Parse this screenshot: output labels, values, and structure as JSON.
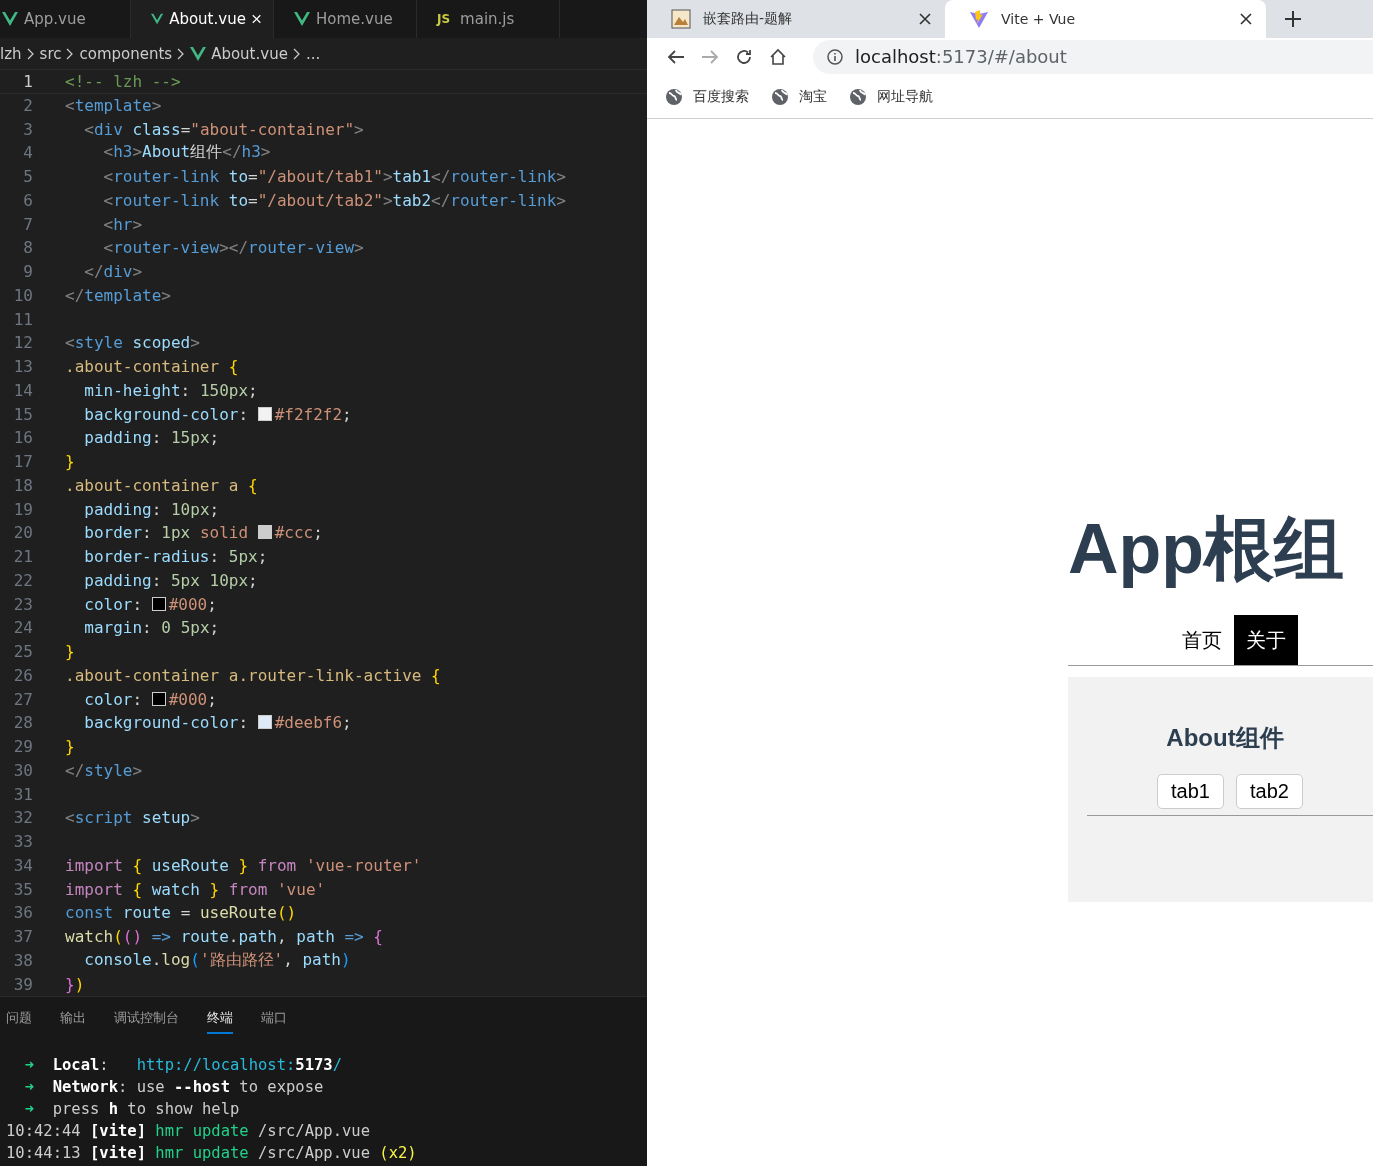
{
  "editor": {
    "tabs": [
      {
        "label": "App.vue",
        "kind": "vue",
        "selected": false
      },
      {
        "label": "About.vue",
        "kind": "vue",
        "selected": true
      },
      {
        "label": "Home.vue",
        "kind": "vue",
        "selected": false
      },
      {
        "label": "main.js",
        "kind": "js",
        "icon_text": "JS",
        "selected": false
      }
    ],
    "breadcrumbs": [
      {
        "label": "lzh",
        "kind": "folder"
      },
      {
        "label": "src",
        "kind": "folder"
      },
      {
        "label": "components",
        "kind": "folder"
      },
      {
        "label": "About.vue",
        "kind": "vue"
      },
      {
        "label": "...",
        "kind": "symbol"
      }
    ],
    "lines": [
      {
        "n": "1",
        "active": true,
        "text": "<!-- lzh -->"
      },
      {
        "n": "2",
        "active": false,
        "text": "<template>"
      },
      {
        "n": "3",
        "active": false,
        "text": "  <div class=\"about-container\">"
      },
      {
        "n": "4",
        "active": false,
        "text": "    <h3>About组件</h3>"
      },
      {
        "n": "5",
        "active": false,
        "text": "    <router-link to=\"/about/tab1\">tab1</router-link>"
      },
      {
        "n": "6",
        "active": false,
        "text": "    <router-link to=\"/about/tab2\">tab2</router-link>"
      },
      {
        "n": "7",
        "active": false,
        "text": "    <hr>"
      },
      {
        "n": "8",
        "active": false,
        "text": "    <router-view></router-view>"
      },
      {
        "n": "9",
        "active": false,
        "text": "  </div>"
      },
      {
        "n": "10",
        "active": false,
        "text": "</template>"
      },
      {
        "n": "11",
        "active": false
      },
      {
        "n": "12",
        "active": false,
        "text": "<style scoped>"
      },
      {
        "n": "13",
        "active": false,
        "text": ".about-container {"
      },
      {
        "n": "14",
        "active": false,
        "text": "  min-height: 150px;"
      },
      {
        "n": "15",
        "active": false,
        "text": "  background-color: #f2f2f2;"
      },
      {
        "n": "16",
        "active": false,
        "text": "  padding: 15px;"
      },
      {
        "n": "17",
        "active": false,
        "text": "}"
      },
      {
        "n": "18",
        "active": false,
        "text": ".about-container a {"
      },
      {
        "n": "19",
        "active": false,
        "text": "  padding: 10px;"
      },
      {
        "n": "20",
        "active": false,
        "text": "  border: 1px solid #ccc;"
      },
      {
        "n": "21",
        "active": false,
        "text": "  border-radius: 5px;"
      },
      {
        "n": "22",
        "active": false,
        "text": "  padding: 5px 10px;"
      },
      {
        "n": "23",
        "active": false,
        "text": "  color: #000;"
      },
      {
        "n": "24",
        "active": false,
        "text": "  margin: 0 5px;"
      },
      {
        "n": "25",
        "active": false,
        "text": "}"
      },
      {
        "n": "26",
        "active": false,
        "text": ".about-container a.router-link-active {"
      },
      {
        "n": "27",
        "active": false,
        "text": "  color: #000;"
      },
      {
        "n": "28",
        "active": false,
        "text": "  background-color: #deebf6;"
      },
      {
        "n": "29",
        "active": false,
        "text": "}"
      },
      {
        "n": "30",
        "active": false,
        "text": "</style>"
      },
      {
        "n": "31",
        "active": false
      },
      {
        "n": "32",
        "active": false,
        "text": "<script setup>"
      },
      {
        "n": "33",
        "active": false
      },
      {
        "n": "34",
        "active": false,
        "text": "import { useRoute } from 'vue-router'"
      },
      {
        "n": "35",
        "active": false,
        "text": "import { watch } from 'vue'"
      },
      {
        "n": "36",
        "active": false,
        "text": "const route = useRoute()"
      },
      {
        "n": "37",
        "active": false,
        "text": "watch(() => route.path, path => {"
      },
      {
        "n": "38",
        "active": false,
        "text": "  console.log('路由路径', path)"
      },
      {
        "n": "39",
        "active": false,
        "text": "})"
      }
    ]
  },
  "panel": {
    "tabs": [
      {
        "label": "问题",
        "selected": false
      },
      {
        "label": "输出",
        "selected": false
      },
      {
        "label": "调试控制台",
        "selected": false
      },
      {
        "label": "终端",
        "selected": true
      },
      {
        "label": "端口",
        "selected": false
      }
    ],
    "terminal_lines": [
      "  ➜  **Local**:   http://localhost:**5173**/",
      "  ➜  **Network**: use **--host** to expose",
      "  ➜  press **h** to show help",
      "10:42:44 **[vite]** hmr update /src/App.vue",
      "10:44:13 **[vite]** hmr update /src/App.vue (x2)"
    ]
  },
  "browser": {
    "tabs": [
      {
        "title": "嵌套路由-题解",
        "kind": "page",
        "selected": false
      },
      {
        "title": "Vite + Vue",
        "kind": "vite",
        "selected": true
      }
    ],
    "address": {
      "host": "localhost",
      "path": ":5173/#/about"
    },
    "bookmarks": [
      "百度搜索",
      "淘宝",
      "网址导航"
    ],
    "page": {
      "heading": "App根组",
      "nav": [
        {
          "label": "首页",
          "selected": false
        },
        {
          "label": "关于",
          "selected": true
        }
      ],
      "about": {
        "title": "About组件",
        "links": [
          {
            "label": "tab1",
            "selected": false
          },
          {
            "label": "tab2",
            "selected": false
          }
        ]
      }
    }
  }
}
